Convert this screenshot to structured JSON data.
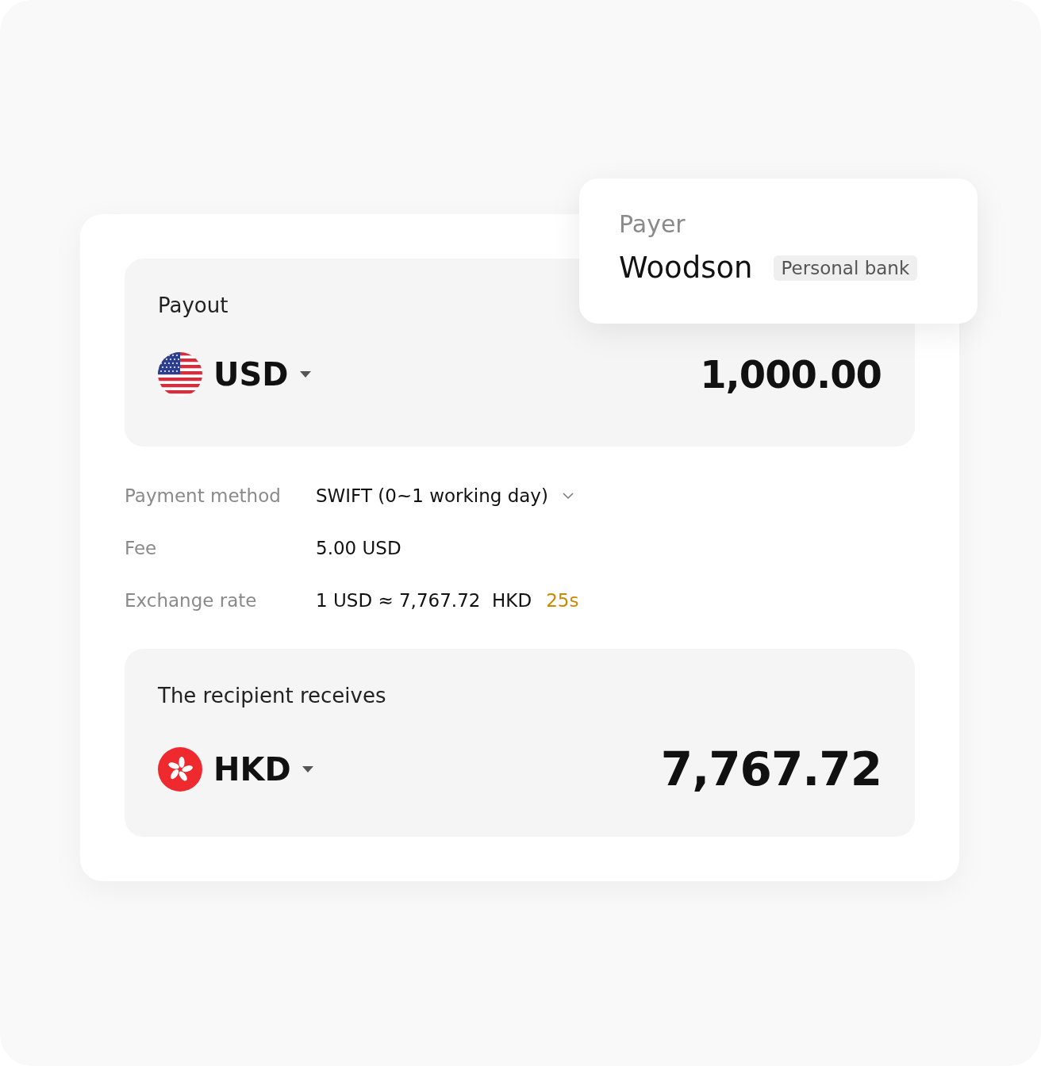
{
  "payer": {
    "label": "Payer",
    "name": "Woodson",
    "tag": "Personal bank"
  },
  "payout": {
    "label": "Payout",
    "currency": "USD",
    "kind": "us",
    "amount": "1,000.00"
  },
  "details": [
    {
      "kind": "dropdown",
      "label": "Payment method",
      "value": "SWIFT (0~1 working day)"
    },
    {
      "kind": "text",
      "label": "Fee",
      "value": "5.00 USD"
    },
    {
      "kind": "rate",
      "label": "Exchange rate",
      "value": "1 USD ≈ 7,767.72  HKD",
      "timer": "25s"
    }
  ],
  "receive": {
    "label": "The recipient receives",
    "currency": "HKD",
    "kind": "hk",
    "amount": "7,767.72"
  }
}
